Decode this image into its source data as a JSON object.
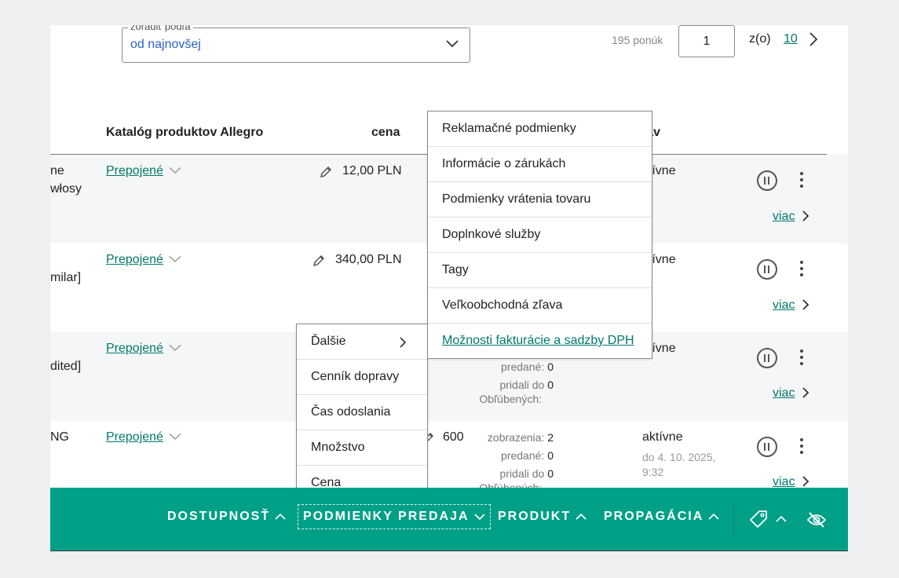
{
  "sort": {
    "label": "zoradiť podľa",
    "value": "od najnovšej"
  },
  "pagination": {
    "offers_count": "195 ponúk",
    "current": "1",
    "of_label": "z(o)",
    "total": "10"
  },
  "table": {
    "headers": {
      "catalog": "Katalóg produktov Allegro",
      "price": "cena",
      "status": "stav"
    },
    "rows": [
      {
        "name_line1": "ne",
        "name_line2": "włosy",
        "catalog": "Prepojené",
        "price": "12,00 PLN",
        "status": "aktívne",
        "more": "viac"
      },
      {
        "name_line1": "",
        "name_line2": "milar]",
        "catalog": "Prepojené",
        "price": "340,00 PLN",
        "status": "aktívne",
        "more": "viac"
      },
      {
        "name_line1": "",
        "name_line2": "dited]",
        "catalog": "Prepojené",
        "status": "aktívne",
        "more": "viac",
        "stats": {
          "sold_label": "predané:",
          "sold": "0",
          "fav_label_1": "pridali do",
          "fav_label_2": "Obľúbených:",
          "fav": "0"
        }
      },
      {
        "name_line1": "NG",
        "catalog": "Prepojené",
        "price": "600",
        "status": "aktívne",
        "status_until": "do 4. 10. 2025,",
        "status_time": "9:32",
        "more": "viac",
        "stats": {
          "views_label": "zobrazenia:",
          "views": "2",
          "sold_label": "predané:",
          "sold": "0",
          "fav_label_1": "pridali do",
          "fav_label_2": "Obľúbených:",
          "fav": "0"
        }
      }
    ]
  },
  "submenu": {
    "items": [
      "Reklamačné podmienky",
      "Informácie o zárukách",
      "Podmienky vrátenia tovaru",
      "Doplnkové služby",
      "Tagy",
      "Veľkoobchodná zľava",
      "Možnosti fakturácie a sadzby DPH"
    ]
  },
  "sale_menu": {
    "items": [
      "Ďalšie",
      "Cenník dopravy",
      "Čas odoslania",
      "Množstvo",
      "Cena"
    ]
  },
  "bottom_bar": {
    "availability": "DOSTUPNOSŤ",
    "sale_terms": "PODMIENKY PREDAJA",
    "product": "PRODUKT",
    "promotion": "PROPAGÁCIA"
  },
  "icons": [
    "chevron-down-icon",
    "chevron-right-icon",
    "chevron-up-icon",
    "pencil-icon",
    "pause-icon",
    "more-vertical-icon",
    "tag-icon",
    "eye-off-icon"
  ],
  "colors": {
    "accent": "#00a087",
    "link": "#00796b",
    "select_text": "#2663cb"
  }
}
